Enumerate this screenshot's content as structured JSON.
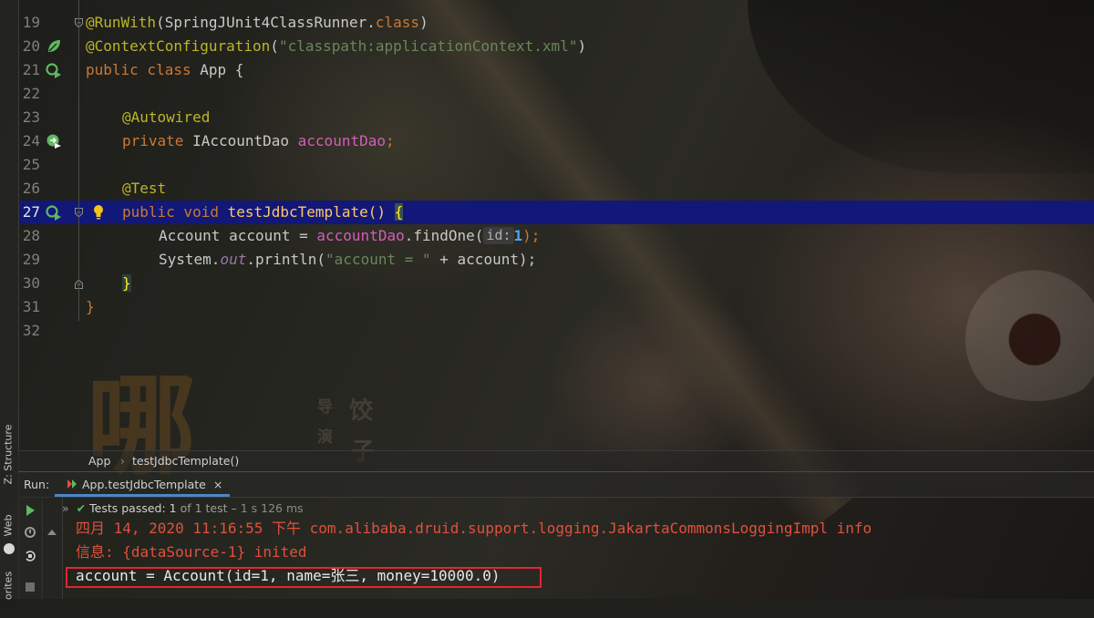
{
  "editor": {
    "line_numbers": [
      "19",
      "20",
      "21",
      "22",
      "23",
      "24",
      "25",
      "26",
      "27",
      "28",
      "29",
      "30",
      "31",
      "32"
    ],
    "active_line": "27",
    "code": {
      "l19_ann": "@RunWith",
      "l19_rest": "(SpringJUnit4ClassRunner.",
      "l19_kw": "class",
      "l19_close": ")",
      "l20_ann": "@ContextConfiguration",
      "l20_open": "(",
      "l20_str": "\"classpath:applicationContext.xml\"",
      "l20_close": ")",
      "l21_kw": "public class ",
      "l21_rest": "App {",
      "l23_ann": "@Autowired",
      "l24_kw": "private ",
      "l24_type": "IAccountDao ",
      "l24_field": "accountDao",
      "l24_semi": ";",
      "l26_ann": "@Test",
      "l27_kw": "public void ",
      "l27_name": "testJdbcTemplate() ",
      "l27_brace": "{",
      "l28_a": "Account account = ",
      "l28_field": "accountDao",
      "l28_b": ".findOne(",
      "l28_hint": "id:",
      "l28_num": "1",
      "l28_c": ");",
      "l29_a": "System.",
      "l29_static": "out",
      "l29_b": ".println(",
      "l29_str": "\"account = \"",
      "l29_c": " + account);",
      "l30_brace": "}",
      "l31_brace": "}"
    }
  },
  "breadcrumb": {
    "items": [
      "App",
      "testJdbcTemplate()"
    ],
    "separator": "›"
  },
  "run_panel": {
    "title": "Run:",
    "tab_label": "App.testJdbcTemplate",
    "close": "×",
    "status": {
      "chevrons": "»",
      "passed": "Tests passed: ",
      "count": "1",
      "of": " of 1 test – ",
      "duration": "1 s 126 ms"
    },
    "console": [
      "四月 14, 2020 11:16:55 下午 com.alibaba.druid.support.logging.JakartaCommonsLoggingImpl info",
      "信息: {dataSource-1} inited",
      "account = Account(id=1, name=张三, money=10000.0)"
    ]
  },
  "side_tabs": {
    "structure": "Z: Structure",
    "web": "Web",
    "favorites": "orites"
  },
  "background_text": {
    "credit_a": "导",
    "credit_b": "饺",
    "credit_c": "演",
    "credit_d": "子"
  },
  "colors": {
    "keyword": "#cc7832",
    "annotation": "#bbb529",
    "string": "#6a8759",
    "field": "#d25eb8",
    "number": "#6897bb",
    "highlight_line": "#121877",
    "console_error": "#e0503c",
    "output_box": "#e2262d",
    "run_icon": "#5fb85f"
  }
}
